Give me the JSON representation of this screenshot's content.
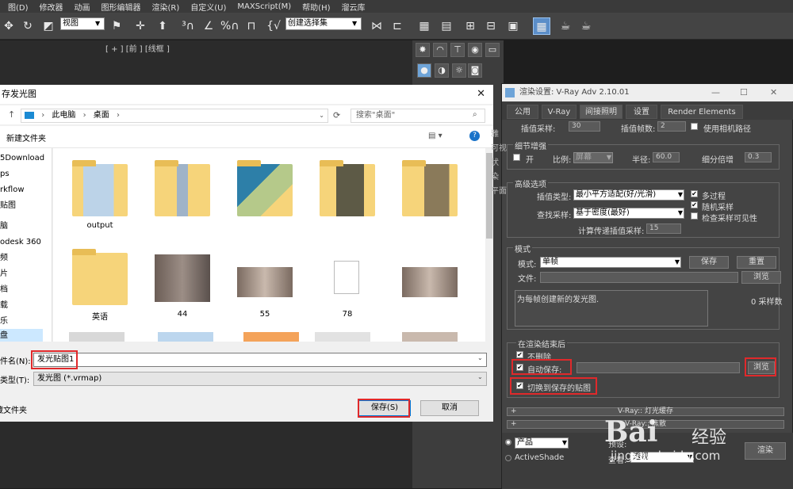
{
  "menu": [
    "图(D)",
    "修改器",
    "动画",
    "图形编辑器",
    "渲染(R)",
    "自定义(U)",
    "MAXScript(M)",
    "帮助(H)",
    "溜云库"
  ],
  "toolbar": {
    "view_combo": "视图",
    "selection_set": "创建选择集"
  },
  "viewport": {
    "label": "[ + ] [前 ] [线框 ]"
  },
  "file_dialog": {
    "title": "存发光图",
    "breadcrumb": [
      "此电脑",
      "桌面"
    ],
    "search_placeholder": "搜索\"桌面\"",
    "new_folder": "新建文件夹",
    "nav_items": [
      "5Download",
      "ps",
      "rkflow",
      "贴图",
      "脑",
      "odesk 360",
      "频",
      "片",
      "档",
      "载",
      "乐",
      "盘"
    ],
    "files": [
      {
        "name": "output",
        "kind": "folder"
      },
      {
        "name": "",
        "kind": "folder"
      },
      {
        "name": "",
        "kind": "folder"
      },
      {
        "name": "",
        "kind": "folder"
      },
      {
        "name": "",
        "kind": "folder"
      },
      {
        "name": "英语",
        "kind": "folder"
      },
      {
        "name": "44",
        "kind": "image"
      },
      {
        "name": "55",
        "kind": "image"
      },
      {
        "name": "78",
        "kind": "doc"
      },
      {
        "name": "",
        "kind": "image"
      }
    ],
    "filename_label": "文件名(N):",
    "filename_value": "发光贴图1",
    "filetype_label": "保存类型(T):",
    "filetype_value": "发光图 (*.vrmap)",
    "hide_folders": "隐藏文件夹",
    "save_button": "保存(S)",
    "cancel_button": "取消"
  },
  "vray": {
    "title": "渲染设置: V-Ray Adv 2.10.01",
    "tabs": [
      "公用",
      "V-Ray",
      "间接照明",
      "设置",
      "Render Elements"
    ],
    "top_row": {
      "interp_samples": "插值采样:",
      "interp_samples_val": "30",
      "interp_frames": "插值帧数:",
      "interp_frames_val": "2",
      "use_camera_path": "使用相机路径"
    },
    "side_labels": [
      "雅",
      "可视",
      "状",
      "染",
      "平面"
    ],
    "detail": {
      "title": "细节增强",
      "on": "开",
      "scale_label": "比例:",
      "scale_value": "屏幕",
      "radius_label": "半径:",
      "radius_value": "60.0",
      "subdiv_label": "细分倍增",
      "subdiv_value": "0.3"
    },
    "advanced": {
      "title": "高级选项",
      "interp_type_label": "插值类型:",
      "interp_type_value": "最小平方适配(好/光滑)",
      "multipass": "多过程",
      "lookup_label": "查找采样:",
      "lookup_value": "基于密度(最好)",
      "random": "随机采样",
      "check_visibility": "检查采样可见性",
      "calc_label": "计算传递插值采样:",
      "calc_value": "15"
    },
    "mode": {
      "title": "模式",
      "mode_label": "模式:",
      "mode_value": "单帧",
      "save": "保存",
      "reset": "重置",
      "file_label": "文件:",
      "browse": "浏览",
      "desc": "为每帧创建新的发光图.",
      "samples": "0 采样数"
    },
    "after": {
      "title": "在渲染结束后",
      "no_delete": "不删除",
      "auto_save": "自动保存:",
      "browse": "浏览",
      "switch_saved": "切换到保存的贴图"
    },
    "rollouts": [
      "V-Ray:: 灯光缓存",
      "V-Ray:: 焦散"
    ],
    "bottom": {
      "product": "产品",
      "activeshade": "ActiveShade",
      "preset": "预设:",
      "view": "查看:",
      "view_value": "透视",
      "render": "渲染"
    }
  },
  "watermark": {
    "brand": "Bai",
    "jy": "经验",
    "url": "jingyan.baidu.com"
  },
  "colors": {
    "highlight": "#e0292b",
    "accent": "#5b8ec9",
    "folder": "#f6d47a"
  }
}
